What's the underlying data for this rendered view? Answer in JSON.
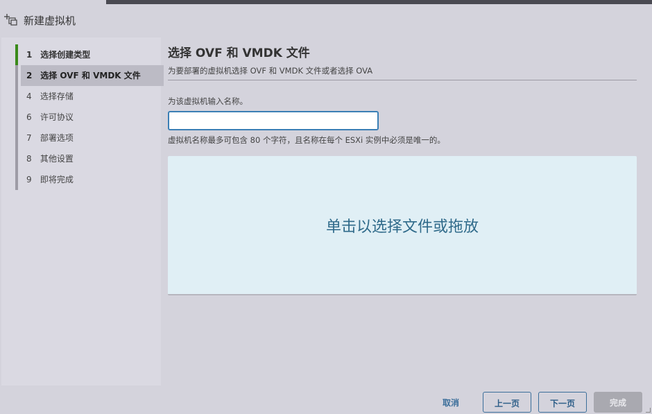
{
  "window": {
    "title": "新建虚拟机"
  },
  "steps": [
    {
      "num": "1",
      "label": "选择创建类型",
      "state": "done"
    },
    {
      "num": "2",
      "label": "选择 OVF 和 VMDK 文件",
      "state": "active"
    },
    {
      "num": "4",
      "label": "选择存储",
      "state": "pending"
    },
    {
      "num": "6",
      "label": "许可协议",
      "state": "pending"
    },
    {
      "num": "7",
      "label": "部署选项",
      "state": "pending"
    },
    {
      "num": "8",
      "label": "其他设置",
      "state": "pending"
    },
    {
      "num": "9",
      "label": "即将完成",
      "state": "pending"
    }
  ],
  "main": {
    "title": "选择 OVF 和 VMDK 文件",
    "subtitle": "为要部署的虚拟机选择 OVF 和 VMDK 文件或者选择 OVA",
    "name_label": "为该虚拟机输入名称。",
    "name_value": "",
    "name_hint": "虚拟机名称最多可包含 80 个字符，且名称在每个 ESXi 实例中必须是唯一的。",
    "dropzone_text": "单击以选择文件或拖放"
  },
  "footer": {
    "cancel": "取消",
    "prev": "上一页",
    "next": "下一页",
    "finish": "完成"
  },
  "colors": {
    "accent": "#3b7fb5",
    "done_marker": "#3a8a1a",
    "dropzone_bg": "#e0eff5"
  },
  "icons": {
    "title_icon": "new-vm-icon"
  }
}
